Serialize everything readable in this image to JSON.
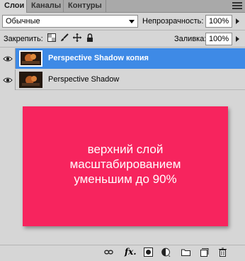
{
  "tabs": [
    {
      "label": "Слои",
      "active": true
    },
    {
      "label": "Каналы",
      "active": false
    },
    {
      "label": "Контуры",
      "active": false
    }
  ],
  "blend_mode": "Обычные",
  "opacity": {
    "label": "Непрозрачность:",
    "value": "100%"
  },
  "lock": {
    "label": "Закрепить:"
  },
  "fill": {
    "label": "Заливка:",
    "value": "100%"
  },
  "layers": [
    {
      "name": "Perspective Shadow копия",
      "selected": true,
      "visible": true
    },
    {
      "name": "Perspective Shadow",
      "selected": false,
      "visible": true
    }
  ],
  "note": {
    "lines": [
      "верхний слой",
      "масштабированием",
      "уменьшим до 90%"
    ],
    "color": "#f7245e"
  },
  "bottom_icons": [
    "link-icon",
    "fx-icon",
    "mask-icon",
    "adjustment-icon",
    "group-folder-icon",
    "new-layer-icon",
    "trash-icon"
  ],
  "colors": {
    "selection": "#3e8ae6",
    "panel": "#d6d6d6"
  }
}
